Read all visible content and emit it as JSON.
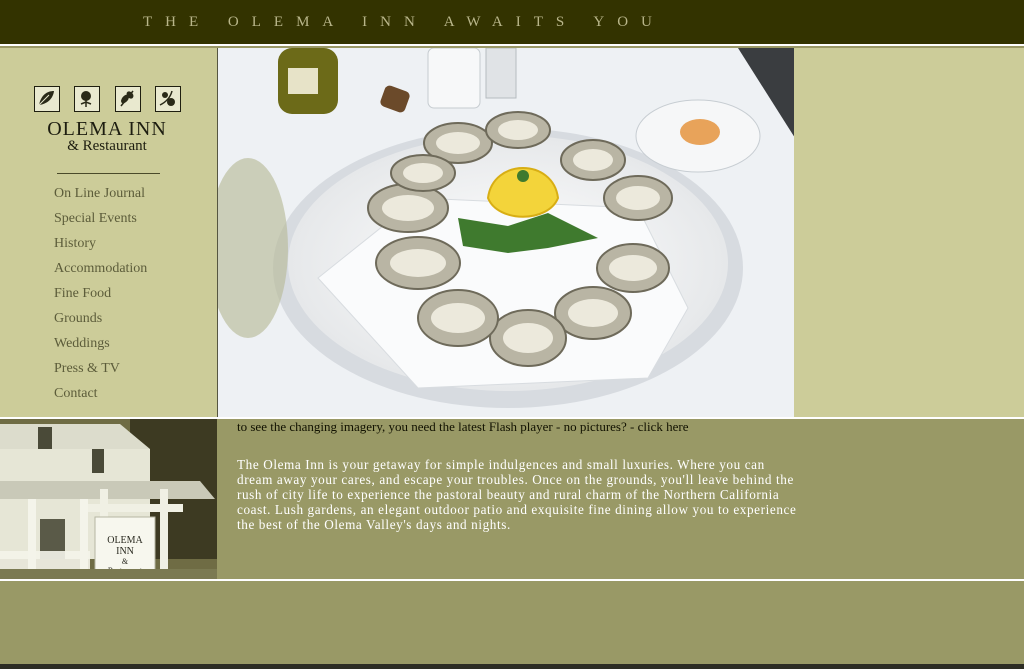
{
  "header": {
    "tagline": "THE OLEMA INN AWAITS YOU"
  },
  "logo": {
    "title": "OLEMA INN",
    "subtitle": "& Restaurant"
  },
  "nav": {
    "items": [
      {
        "label": "On Line Journal"
      },
      {
        "label": "Special Events"
      },
      {
        "label": "History"
      },
      {
        "label": "Accommodation"
      },
      {
        "label": "Fine Food"
      },
      {
        "label": "Grounds"
      },
      {
        "label": "Weddings"
      },
      {
        "label": "Press & TV"
      },
      {
        "label": "Contact"
      }
    ]
  },
  "photo_sign": {
    "line1": "OLEMA",
    "line2": "INN",
    "line3": "&",
    "line4": "Restaurant"
  },
  "flash_note": {
    "text": "to see the changing imagery, you need the latest Flash player - no pictures? - ",
    "link": "click here"
  },
  "intro": "The Olema Inn is your getaway for simple indulgences and small luxuries. Where you can dream away your cares, and escape your troubles. Once on the grounds, you'll leave behind the rush of city life to experience the pastoral beauty and rural charm of the Northern California coast. Lush gardens, an elegant outdoor patio and exquisite fine dining allow you to experience the best of the Olema Valley's days and nights."
}
